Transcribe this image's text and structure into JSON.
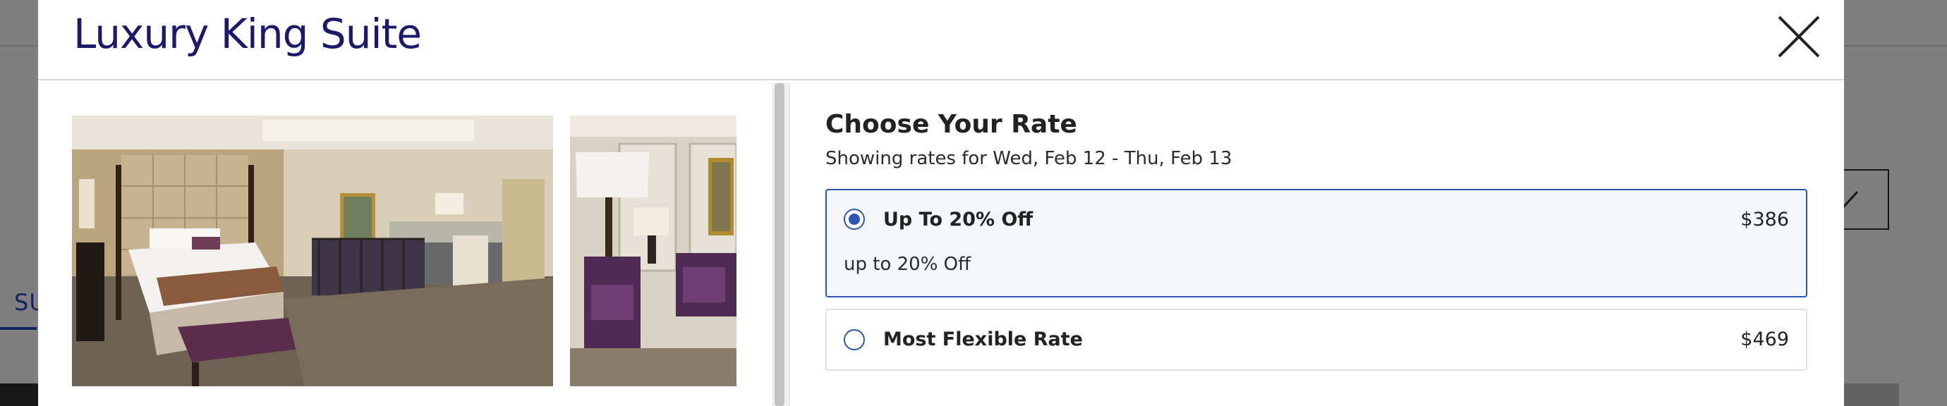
{
  "background": {
    "tab_label": "SU"
  },
  "modal": {
    "title": "Luxury King Suite",
    "close_icon": "close-icon"
  },
  "photos": [
    {
      "name": "room-photo-bedroom",
      "alt": "suite bedroom"
    },
    {
      "name": "room-photo-living-area",
      "alt": "suite living area"
    }
  ],
  "rates": {
    "heading": "Choose Your Rate",
    "subheading": "Showing rates for Wed, Feb 12 - Thu, Feb 13",
    "options": [
      {
        "name": "Up To 20% Off",
        "price": "$386",
        "description": "up to 20% Off",
        "selected": true
      },
      {
        "name": "Most Flexible Rate",
        "price": "$469",
        "selected": false
      }
    ]
  },
  "colors": {
    "title": "#1a1a6c",
    "accent": "#2b56b3",
    "selected_bg": "#f4f6fa",
    "overlay": "rgba(0,0,0,0.5)"
  }
}
